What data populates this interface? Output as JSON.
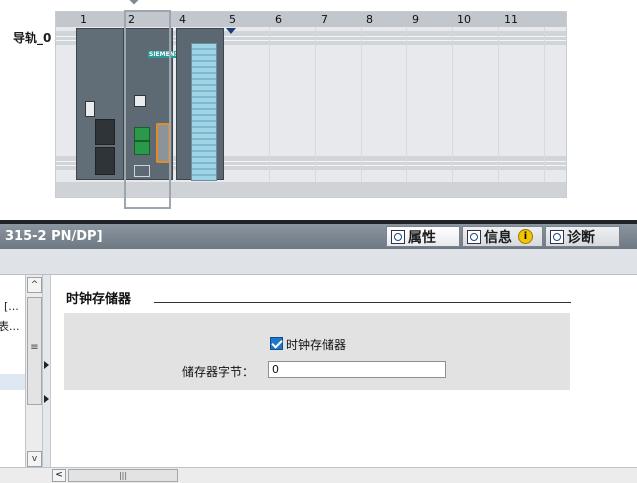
{
  "rack": {
    "rail_label": "导轨_0",
    "slots": [
      "1",
      "2",
      "4",
      "5",
      "6",
      "7",
      "8",
      "9",
      "10",
      "11"
    ],
    "cpu_brand": "SIEMENS"
  },
  "inspector": {
    "title": "315-2 PN/DP]",
    "tabs": [
      {
        "label": "属性",
        "icon": "properties-icon"
      },
      {
        "label": "信息",
        "icon": "info-list-icon"
      },
      {
        "label": "诊断",
        "icon": "diagnostics-icon"
      }
    ],
    "info_badge": "i"
  },
  "nav": {
    "items": [
      "[...",
      "表..."
    ]
  },
  "content": {
    "section_title": "时钟存储器",
    "checkbox_label": "时钟存储器",
    "checkbox_checked": true,
    "field_label": "储存器字节：",
    "field_value": "0"
  },
  "scroll": {
    "up": "^",
    "down": "v",
    "thumb_grip": "≡",
    "left": "<",
    "hgrip": "|||"
  }
}
